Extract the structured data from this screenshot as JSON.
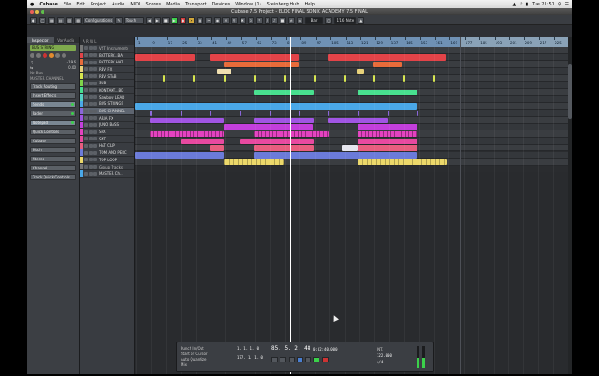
{
  "menubar": {
    "apple": "",
    "app": "Cubase",
    "items": [
      "File",
      "Edit",
      "Project",
      "Audio",
      "MIDI",
      "Scores",
      "Media",
      "Transport",
      "Devices",
      "Window (1)",
      "Steinberg Hub",
      "Help"
    ],
    "clock": "Tue 21:51"
  },
  "window": {
    "title": "Cubase 7.5 Project - ELOC FINAL SONIC ACADEMY 7.5 FINAL"
  },
  "toolbar": {
    "preset": "Configurations",
    "mode": "Touch",
    "grid": "Bar",
    "quantize": "1/16 Note"
  },
  "inspector": {
    "tabs": [
      "Inspector",
      "VariAudio"
    ],
    "track_name": "BUS STRING",
    "volume_label": "-19.6",
    "pan_label": "0.00",
    "routing_in": "No Bus",
    "routing_out": "MASTER CHANNEL",
    "sections": [
      "Track Routing",
      "Insert Effects",
      "Sends",
      "Fader",
      "Notepad",
      "Quick Controls",
      "Cubase",
      "Pitch",
      "Stereo",
      "Channel",
      "Track Quick Controls"
    ]
  },
  "tracklist": {
    "header": "A  R  W  L",
    "tracks": [
      {
        "name": "VST Instruments",
        "color": "#777777"
      },
      {
        "name": "BATTERY...BA",
        "color": "#e34348"
      },
      {
        "name": "BATTERY HAT",
        "color": "#e86b3a"
      },
      {
        "name": "REV FX",
        "color": "#e8d27a"
      },
      {
        "name": "REV STAB",
        "color": "#d7e64d"
      },
      {
        "name": "SUB",
        "color": "#7fd44a"
      },
      {
        "name": "KONTAKT...BD",
        "color": "#48e08f"
      },
      {
        "name": "Sawbow LEAD",
        "color": "#56d0c4"
      },
      {
        "name": "BUS STRINGS",
        "color": "#4aa8e8"
      },
      {
        "name": "BUS CHANNEL",
        "color": "#8a66d9"
      },
      {
        "name": "ARIA FX",
        "color": "#a055e3"
      },
      {
        "name": "JUNO BASS",
        "color": "#c33fdc"
      },
      {
        "name": "SFX",
        "color": "#e442c0"
      },
      {
        "name": "SNT",
        "color": "#e849a0"
      },
      {
        "name": "HAT CLIP",
        "color": "#e85d7f"
      },
      {
        "name": "TOM AND PERC",
        "color": "#6b7bd9"
      },
      {
        "name": "TOP LOOP",
        "color": "#ecd86a"
      },
      {
        "name": "Group Tracks",
        "color": "#777777"
      },
      {
        "name": "MASTER Ch...",
        "color": "#4aa8e8"
      }
    ]
  },
  "ruler": {
    "ticks": [
      "1",
      "9",
      "17",
      "25",
      "33",
      "41",
      "49",
      "57",
      "65",
      "73",
      "81",
      "89",
      "97",
      "105",
      "113",
      "121",
      "129",
      "137",
      "145",
      "153",
      "161",
      "169",
      "177",
      "185",
      "193",
      "201",
      "209",
      "217",
      "225"
    ]
  },
  "transport": {
    "markers": [
      "Punch In/Out",
      "Start or Cursor",
      "Auto Quantize",
      "Mix"
    ],
    "position": "1. 1. 1.  0",
    "position2": "177. 1. 1.  0",
    "tempo": "85. 5. 2. 48",
    "time": "0:02:40.000",
    "sync": "INT.",
    "tempo_value": "122.000",
    "signature": "4/4"
  }
}
